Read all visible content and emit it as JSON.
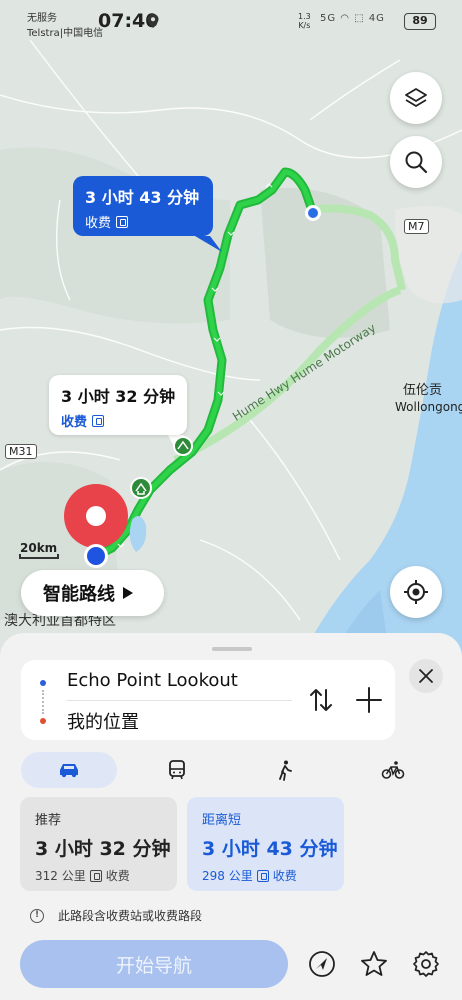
{
  "status_bar": {
    "carrier_line1": "无服务",
    "carrier_line2": "Telstra|中国电信",
    "time": "07:40",
    "net_speed_value": "1.3",
    "net_speed_unit": "K/s",
    "signal_icons": "5G  ◠  ⬚  4G",
    "battery": "89"
  },
  "map": {
    "callout_short_distance": {
      "duration": "3 小时 43 分钟",
      "toll_label": "收费"
    },
    "callout_recommended": {
      "duration": "3 小时 32 分钟",
      "toll_label": "收费"
    },
    "road_label_hume": "Hume Hwy Hume Motorway",
    "road_shield_m7": "M7",
    "road_shield_m31": "M31",
    "city_label_cn": "伍伦贡",
    "city_label_en": "Wollongong",
    "region_label": "澳大利亚首都特区",
    "scale_label": "20km",
    "smart_route_label": "智能路线",
    "route_color_primary": "#1fbf3a",
    "route_color_alternative": "#9ee19f"
  },
  "route_panel": {
    "origin": "Echo Point Lookout",
    "destination": "我的位置",
    "modes": [
      "car",
      "transit",
      "walk",
      "bike"
    ],
    "active_mode": "car",
    "options": [
      {
        "tag": "推荐",
        "duration": "3 小时 32 分钟",
        "distance": "312 公里",
        "toll": "收费",
        "selected": false
      },
      {
        "tag": "距离短",
        "duration": "3 小时 43 分钟",
        "distance": "298 公里",
        "toll": "收费",
        "selected": true
      }
    ],
    "notice": "此路段含收费站或收费路段",
    "start_button": "开始导航"
  },
  "colors": {
    "accent": "#1a5ad6",
    "start_button": "#a9c1ee",
    "destination_pin": "#e53935"
  }
}
